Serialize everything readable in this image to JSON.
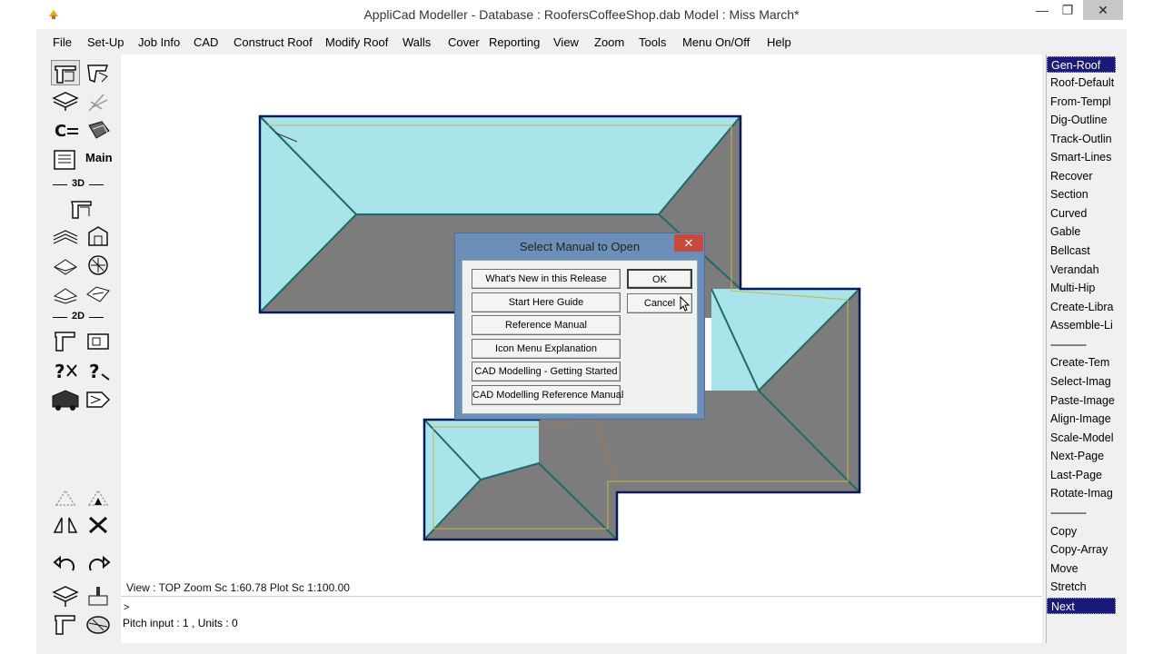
{
  "window": {
    "title": "AppliCad Modeller - Database : RoofersCoffeeShop.dab   Model : Miss March*",
    "controls": [
      "—",
      "❐",
      "✕"
    ]
  },
  "menu": [
    "File",
    "Set-Up",
    "Job Info",
    "CAD",
    "Construct Roof",
    "Modify Roof",
    "Walls",
    "Cover",
    "Reporting",
    "View",
    "Zoom",
    "Tools",
    "Menu On/Off",
    "Help"
  ],
  "toolbar": {
    "main_label": "Main",
    "section_3d": "3D",
    "section_2d": "2D"
  },
  "side_menu": {
    "items": [
      "Gen-Roof",
      "Roof-Default",
      "From-Templ",
      "Dig-Outline",
      "Track-Outlin",
      "Smart-Lines",
      "Recover",
      "Section",
      "Curved",
      "Gable",
      "Bellcast",
      "Verandah",
      "Multi-Hip",
      "Create-Libra",
      "Assemble-Li",
      "-------------",
      "Create-Tem",
      "Select-Imag",
      "Paste-Image",
      "Align-Image",
      "Scale-Model",
      "Next-Page",
      "Last-Page",
      "Rotate-Imag",
      "-------------",
      "Copy",
      "Copy-Array",
      "Move",
      "Stretch",
      "Next"
    ],
    "selected": [
      "Gen-Roof",
      "Next"
    ]
  },
  "status": {
    "view_text": "View : TOP  Zoom Sc 1:60.78   Plot Sc 1:100.00",
    "prompt": ">",
    "output": "Pitch input : 1 , Units : 0"
  },
  "dialog": {
    "title": "Select Manual to Open",
    "close": "✕",
    "manuals": [
      "What's New in this Release",
      "Start Here Guide",
      "Reference Manual",
      "Icon Menu Explanation",
      "CAD Modelling - Getting Started",
      "CAD Modelling Reference Manual"
    ],
    "ok_label": "OK",
    "cancel_label": "Cancel"
  },
  "colors": {
    "roof_face_light": "#a8e4ea",
    "roof_face_dark": "#7c7c7c",
    "outline": "#0a1a5a",
    "ridge": "#1e6a6a",
    "selection": "#1a1a7a"
  }
}
